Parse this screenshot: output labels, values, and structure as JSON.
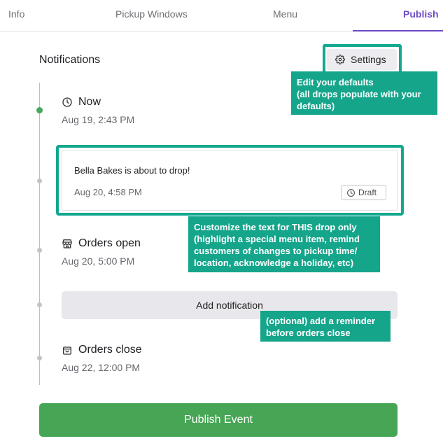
{
  "tabs": [
    {
      "label": "Info",
      "active": false
    },
    {
      "label": "Pickup Windows",
      "active": false
    },
    {
      "label": "Menu",
      "active": false
    },
    {
      "label": "Publish",
      "active": true
    }
  ],
  "section": {
    "title": "Notifications"
  },
  "settings_button": {
    "label": "Settings",
    "icon": "gear-icon"
  },
  "tooltips": {
    "settings": [
      "Edit your defaults",
      "(all drops populate with your",
      "defaults)"
    ],
    "customize": [
      "Customize the text for THIS drop only",
      "(highlight a special menu item, remind",
      "customers of changes to pickup time/",
      "location, acknowledge a holiday, etc)"
    ],
    "reminder": [
      "(optional) add a reminder",
      "before orders close"
    ]
  },
  "timeline": {
    "now": {
      "title": "Now",
      "date": "Aug 19, 2:43 PM",
      "icon": "clock-icon"
    },
    "notification_card": {
      "text": "Bella Bakes is about to drop!",
      "date": "Aug 20, 4:58 PM",
      "badge": "Draft",
      "badge_icon": "clock-icon"
    },
    "orders_open": {
      "title": "Orders open",
      "date": "Aug 20, 5:00 PM",
      "icon": "store-icon"
    },
    "add_notification": {
      "label": "Add notification"
    },
    "orders_close": {
      "title": "Orders close",
      "date": "Aug 22, 12:00 PM",
      "icon": "bag-icon"
    }
  },
  "publish_button": {
    "label": "Publish Event"
  },
  "colors": {
    "accent": "#6c4bc4",
    "highlight": "#13a890",
    "success": "#46a655",
    "timeline_active": "#45a85a"
  }
}
